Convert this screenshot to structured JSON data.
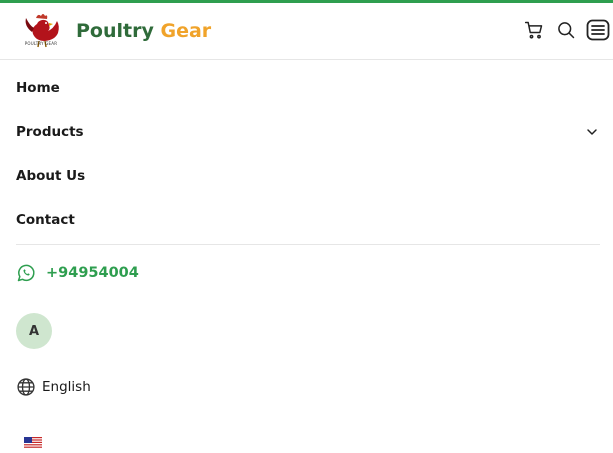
{
  "brand": {
    "name_part1": "Poultry",
    "name_part2": "Gear",
    "logo_caption": "POULTRY GEAR",
    "logo_icon": "rooster-icon",
    "colors": {
      "green": "#2f6b3a",
      "orange": "#f0a32a",
      "accent": "#2e9e4f"
    }
  },
  "header": {
    "icons": [
      "cart-icon",
      "search-icon",
      "menu-icon"
    ]
  },
  "nav": {
    "items": [
      {
        "label": "Home"
      },
      {
        "label": "Products",
        "icon": "chevron-down-icon"
      },
      {
        "label": "About Us"
      },
      {
        "label": "Contact"
      }
    ]
  },
  "contact": {
    "phone": "+94954004",
    "icon": "whatsapp-icon"
  },
  "user": {
    "avatar_initial": "A"
  },
  "language": {
    "label": "English",
    "icon": "globe-icon",
    "flag": "us-flag-icon"
  }
}
